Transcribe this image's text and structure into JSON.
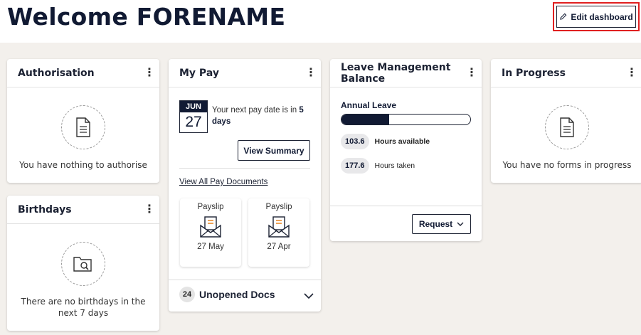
{
  "header": {
    "title": "Welcome FORENAME",
    "edit_label": "Edit dashboard"
  },
  "authorisation": {
    "title": "Authorisation",
    "empty_text": "You have nothing to authorise",
    "icon": "document-icon"
  },
  "birthdays": {
    "title": "Birthdays",
    "empty_text": "There are no birthdays in the next 7 days",
    "icon": "folder-search-icon"
  },
  "my_pay": {
    "title": "My Pay",
    "month": "JUN",
    "day": "27",
    "next_pay_prefix": "Your next pay date is in ",
    "next_pay_number": "5",
    "next_pay_suffix": "days",
    "view_summary_label": "View Summary",
    "view_all_link": "View All Pay Documents",
    "payslips": [
      {
        "label": "Payslip",
        "date": "27 May"
      },
      {
        "label": "Payslip",
        "date": "27 Apr"
      }
    ],
    "unopened_count": "24",
    "unopened_label": "Unopened Docs"
  },
  "leave": {
    "title": "Leave Management Balance",
    "annual_leave_label": "Annual Leave",
    "used_fraction": 0.37,
    "hours_available_value": "103.6",
    "hours_available_label": "Hours available",
    "hours_taken_value": "177.6",
    "hours_taken_label": "Hours taken",
    "request_label": "Request"
  },
  "in_progress": {
    "title": "In Progress",
    "empty_text": "You have no forms in progress",
    "icon": "document-icon"
  },
  "colors": {
    "navy": "#111a33",
    "accent_orange": "#e8821e",
    "highlight_red": "#e02020",
    "background": "#f3f0ec"
  }
}
